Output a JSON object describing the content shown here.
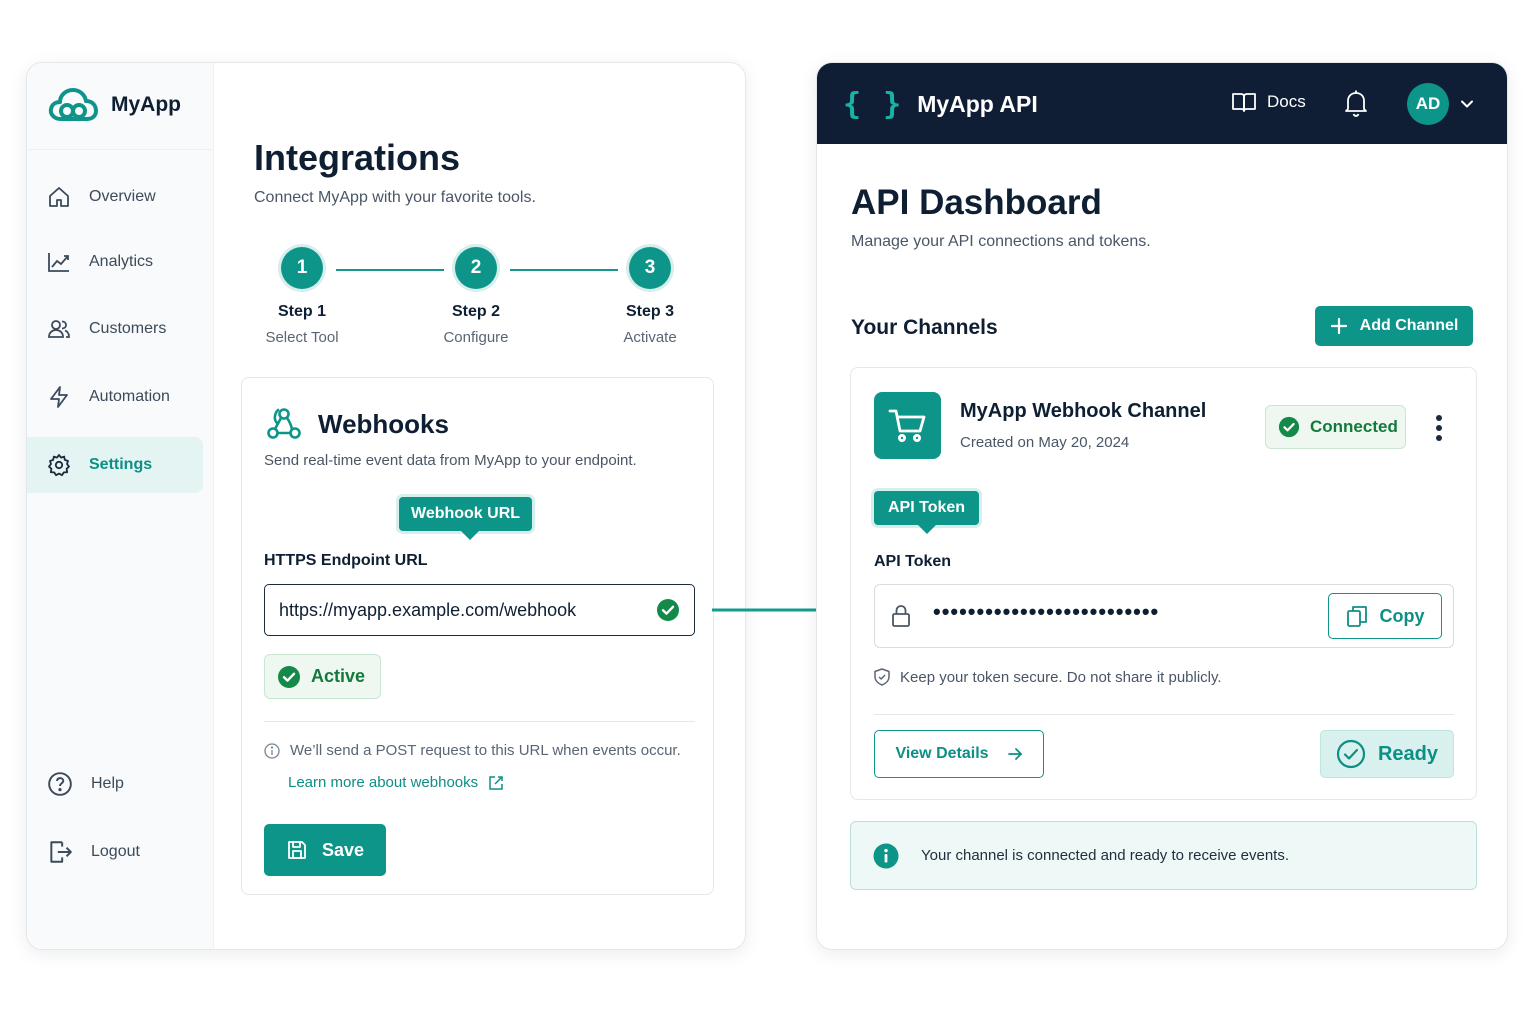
{
  "left": {
    "brand": "MyApp",
    "nav": [
      {
        "label": "Overview",
        "icon": "home-icon"
      },
      {
        "label": "Analytics",
        "icon": "chart-icon"
      },
      {
        "label": "Customers",
        "icon": "users-icon"
      },
      {
        "label": "Automation",
        "icon": "bolt-icon"
      },
      {
        "label": "Settings",
        "icon": "gear-icon",
        "active": true
      }
    ],
    "bottom_nav": [
      {
        "label": "Help",
        "icon": "help-icon"
      },
      {
        "label": "Logout",
        "icon": "logout-icon"
      }
    ],
    "title": "Integrations",
    "subtitle": "Connect MyApp with your favorite tools.",
    "steps": [
      {
        "number": "1",
        "title": "Step 1",
        "subtitle": "Select Tool"
      },
      {
        "number": "2",
        "title": "Step 2",
        "subtitle": "Configure"
      },
      {
        "number": "3",
        "title": "Step 3",
        "subtitle": "Activate"
      }
    ],
    "webhooks": {
      "title": "Webhooks",
      "description": "Send real-time event data from MyApp to your endpoint.",
      "tooltip": "Webhook URL",
      "field_label": "HTTPS Endpoint URL",
      "url": "https://myapp.example.com/webhook",
      "status": "Active",
      "info": "We’ll send a POST request to this URL when events occur.",
      "learn_more": "Learn more about webhooks",
      "save": "Save"
    }
  },
  "right": {
    "brand_icon": "{ }",
    "brand": "MyApp API",
    "docs": "Docs",
    "avatar": "AD",
    "title": "API Dashboard",
    "subtitle": "Manage your API connections and tokens.",
    "channels_title": "Your Channels",
    "add_channel": "Add Channel",
    "channel": {
      "name": "MyApp Webhook Channel",
      "created": "Created on May 20, 2024",
      "status": "Connected",
      "token_tooltip": "API Token",
      "token_label": "API Token",
      "token_mask": "••••••••••••••••••••••••••",
      "copy": "Copy",
      "secure_note": "Keep your token secure. Do not share it publicly.",
      "view_details": "View Details",
      "ready": "Ready"
    },
    "banner": "Your channel is connected and ready to receive events."
  },
  "colors": {
    "accent": "#0e958a",
    "navy": "#0f1e35",
    "success": "#137a3c",
    "success_bg": "#eef8f1"
  }
}
